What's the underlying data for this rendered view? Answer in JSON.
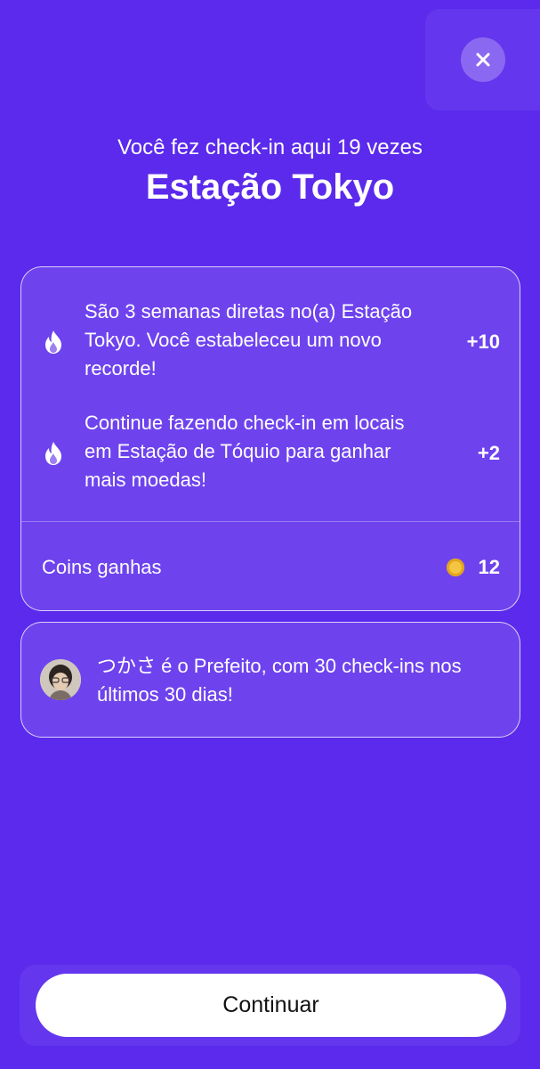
{
  "header": {
    "subtitle": "Você fez check-in aqui 19 vezes",
    "title": "Estação Tokyo"
  },
  "rewards": [
    {
      "icon": "flame-icon",
      "text": "São 3 semanas diretas no(a) Estação Tokyo. Você estabeleceu um novo recorde!",
      "points": "+10"
    },
    {
      "icon": "flame-icon",
      "text": "Continue fazendo check-in em locais em Estação de Tóquio para ganhar mais moedas!",
      "points": "+2"
    }
  ],
  "coins": {
    "label": "Coins ganhas",
    "icon": "coin-icon",
    "value": "12"
  },
  "mayor": {
    "text": "つかさ é o Prefeito, com 30 check-ins nos últimos 30 dias!",
    "avatar": "user-avatar"
  },
  "actions": {
    "continue_label": "Continuar",
    "close_icon": "close-icon"
  },
  "colors": {
    "background": "#5b2aec",
    "coin": "#f4c542",
    "button": "#ffffff"
  }
}
